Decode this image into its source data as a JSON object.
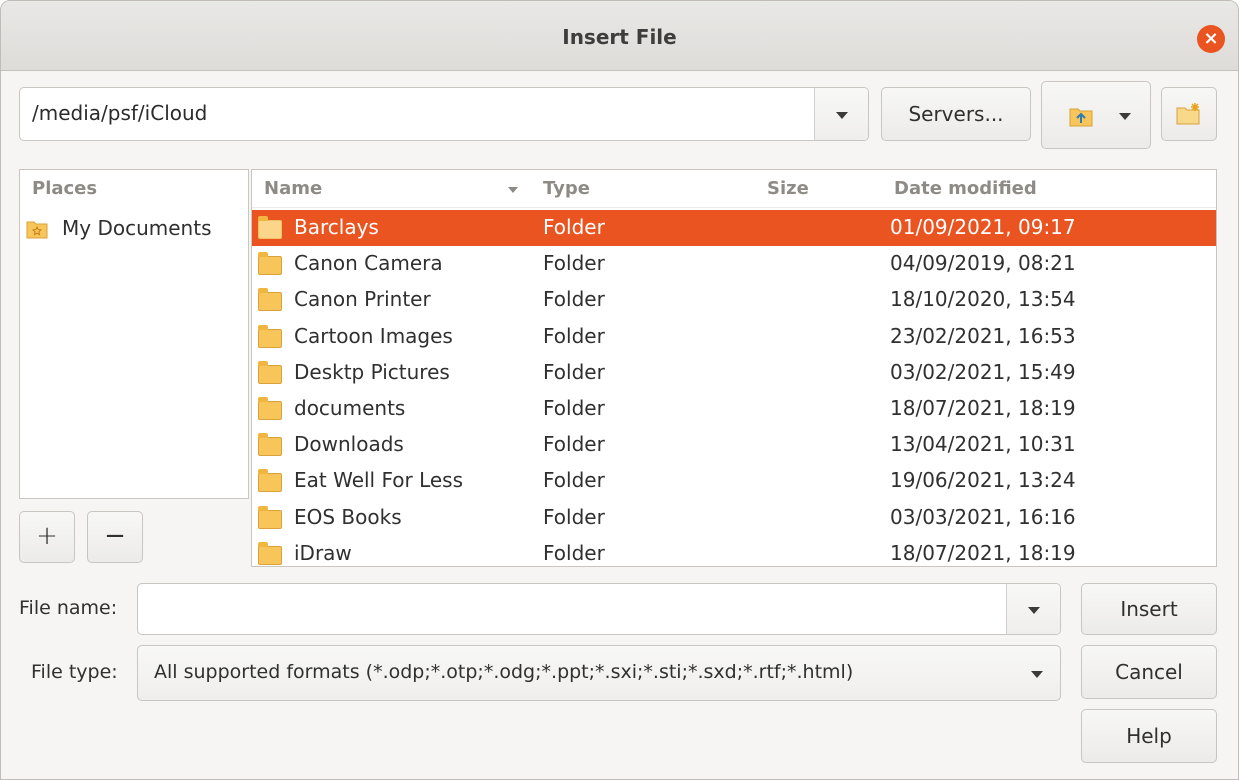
{
  "window": {
    "title": "Insert File",
    "close_glyph": "×"
  },
  "toolbar": {
    "path": "/media/psf/iCloud",
    "servers_label": "Servers...",
    "up_icon": "folder-up-icon",
    "new_folder_icon": "new-folder-icon"
  },
  "places": {
    "header": "Places",
    "items": [
      {
        "label": "My Documents",
        "icon": "documents-folder-icon"
      }
    ],
    "add_glyph": "+",
    "remove_glyph": "−"
  },
  "files": {
    "headers": {
      "name": "Name",
      "type": "Type",
      "size": "Size",
      "date": "Date modified"
    },
    "rows": [
      {
        "name": "Barclays",
        "type": "Folder",
        "size": "",
        "date": "01/09/2021, 09:17",
        "selected": true
      },
      {
        "name": "Canon Camera",
        "type": "Folder",
        "size": "",
        "date": "04/09/2019, 08:21"
      },
      {
        "name": "Canon Printer",
        "type": "Folder",
        "size": "",
        "date": "18/10/2020, 13:54"
      },
      {
        "name": "Cartoon Images",
        "type": "Folder",
        "size": "",
        "date": "23/02/2021, 16:53"
      },
      {
        "name": "Desktp Pictures",
        "type": "Folder",
        "size": "",
        "date": "03/02/2021, 15:49"
      },
      {
        "name": "documents",
        "type": "Folder",
        "size": "",
        "date": "18/07/2021, 18:19"
      },
      {
        "name": "Downloads",
        "type": "Folder",
        "size": "",
        "date": "13/04/2021, 10:31"
      },
      {
        "name": "Eat Well For Less",
        "type": "Folder",
        "size": "",
        "date": "19/06/2021, 13:24"
      },
      {
        "name": "EOS Books",
        "type": "Folder",
        "size": "",
        "date": "03/03/2021, 16:16"
      },
      {
        "name": "iDraw",
        "type": "Folder",
        "size": "",
        "date": "18/07/2021, 18:19"
      }
    ]
  },
  "form": {
    "file_name_label": "File name:",
    "file_name_value": "",
    "file_type_label": "File type:",
    "file_type_value": "All supported formats (*.odp;*.otp;*.odg;*.ppt;*.sxi;*.sti;*.sxd;*.rtf;*.html)"
  },
  "buttons": {
    "insert": "Insert",
    "cancel": "Cancel",
    "help": "Help"
  },
  "colors": {
    "accent": "#e95420"
  }
}
